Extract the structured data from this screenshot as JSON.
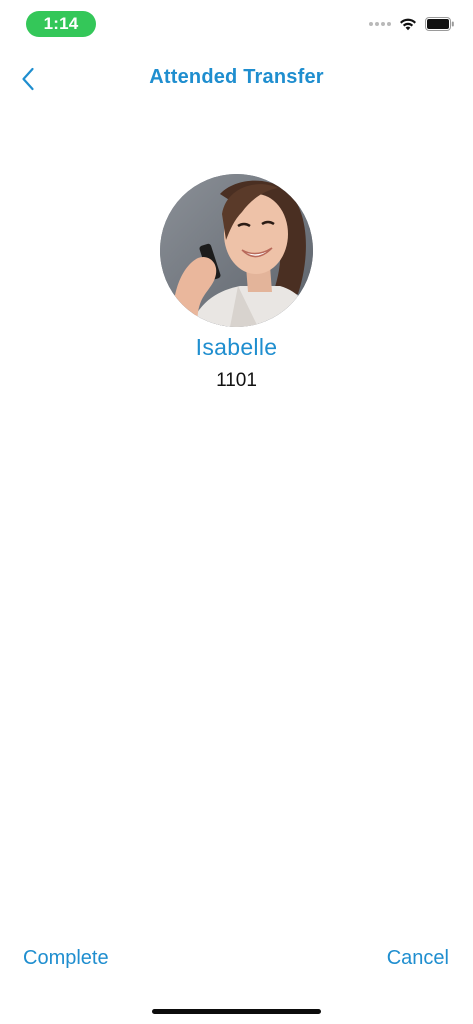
{
  "status_bar": {
    "time": "1:14",
    "icons": [
      "signal-dots-icon",
      "wifi-icon",
      "battery-icon"
    ]
  },
  "nav": {
    "title": "Attended Transfer",
    "back_icon": "chevron-left-icon"
  },
  "contact": {
    "name": "Isabelle",
    "extension": "1101"
  },
  "actions": {
    "complete_label": "Complete",
    "cancel_label": "Cancel"
  },
  "colors": {
    "accent": "#1f8ecf",
    "status_pill": "#34c759",
    "background": "#ffffff"
  }
}
